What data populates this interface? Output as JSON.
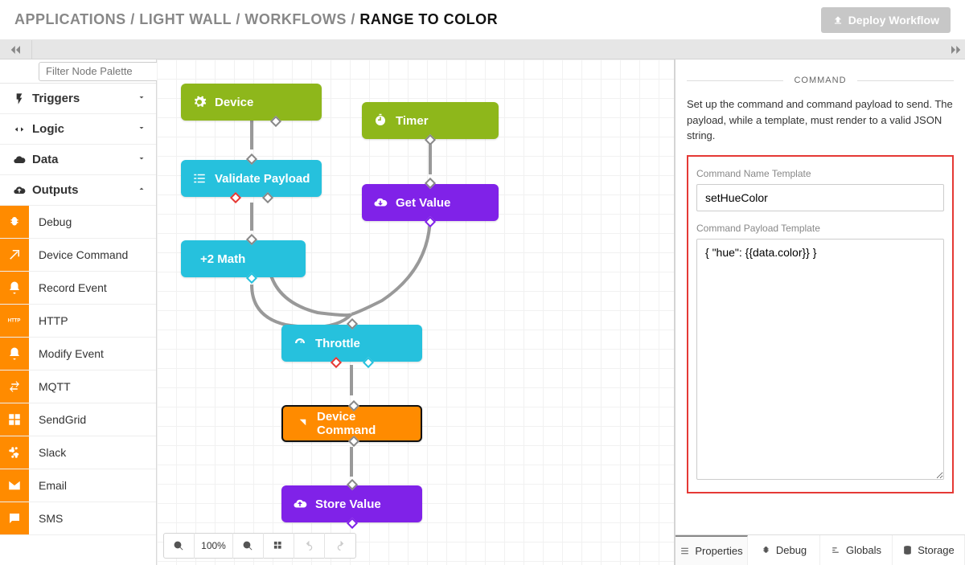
{
  "breadcrumb": {
    "applications": "APPLICATIONS",
    "app": "LIGHT WALL",
    "workflows": "WORKFLOWS",
    "current": "RANGE TO COLOR"
  },
  "header": {
    "deploy_label": "Deploy Workflow"
  },
  "palette": {
    "filter_placeholder": "Filter Node Palette",
    "groups": {
      "triggers": "Triggers",
      "logic": "Logic",
      "data": "Data",
      "outputs": "Outputs"
    },
    "output_items": [
      {
        "label": "Debug",
        "icon": "bug-icon"
      },
      {
        "label": "Device Command",
        "icon": "arrow-up-right-icon"
      },
      {
        "label": "Record Event",
        "icon": "bell-icon"
      },
      {
        "label": "HTTP",
        "icon": "http-icon"
      },
      {
        "label": "Modify Event",
        "icon": "bell-icon"
      },
      {
        "label": "MQTT",
        "icon": "swap-icon"
      },
      {
        "label": "SendGrid",
        "icon": "sendgrid-icon"
      },
      {
        "label": "Slack",
        "icon": "slack-icon"
      },
      {
        "label": "Email",
        "icon": "mail-icon"
      },
      {
        "label": "SMS",
        "icon": "chat-icon"
      }
    ]
  },
  "canvas": {
    "zoom_label": "100%",
    "nodes": {
      "device": "Device",
      "timer": "Timer",
      "validate": "Validate Payload",
      "getvalue": "Get Value",
      "math": "+2  Math",
      "throttle": "Throttle",
      "devicecmd": "Device Command",
      "storevalue": "Store Value"
    }
  },
  "inspector": {
    "section": "COMMAND",
    "hint": "Set up the command and command payload to send. The payload, while a template, must render to a valid JSON string.",
    "name_label": "Command Name Template",
    "name_value": "setHueColor",
    "payload_label": "Command Payload Template",
    "payload_value": "{ \"hue\": {{data.color}} }",
    "tabs": {
      "properties": "Properties",
      "debug": "Debug",
      "globals": "Globals",
      "storage": "Storage"
    }
  }
}
